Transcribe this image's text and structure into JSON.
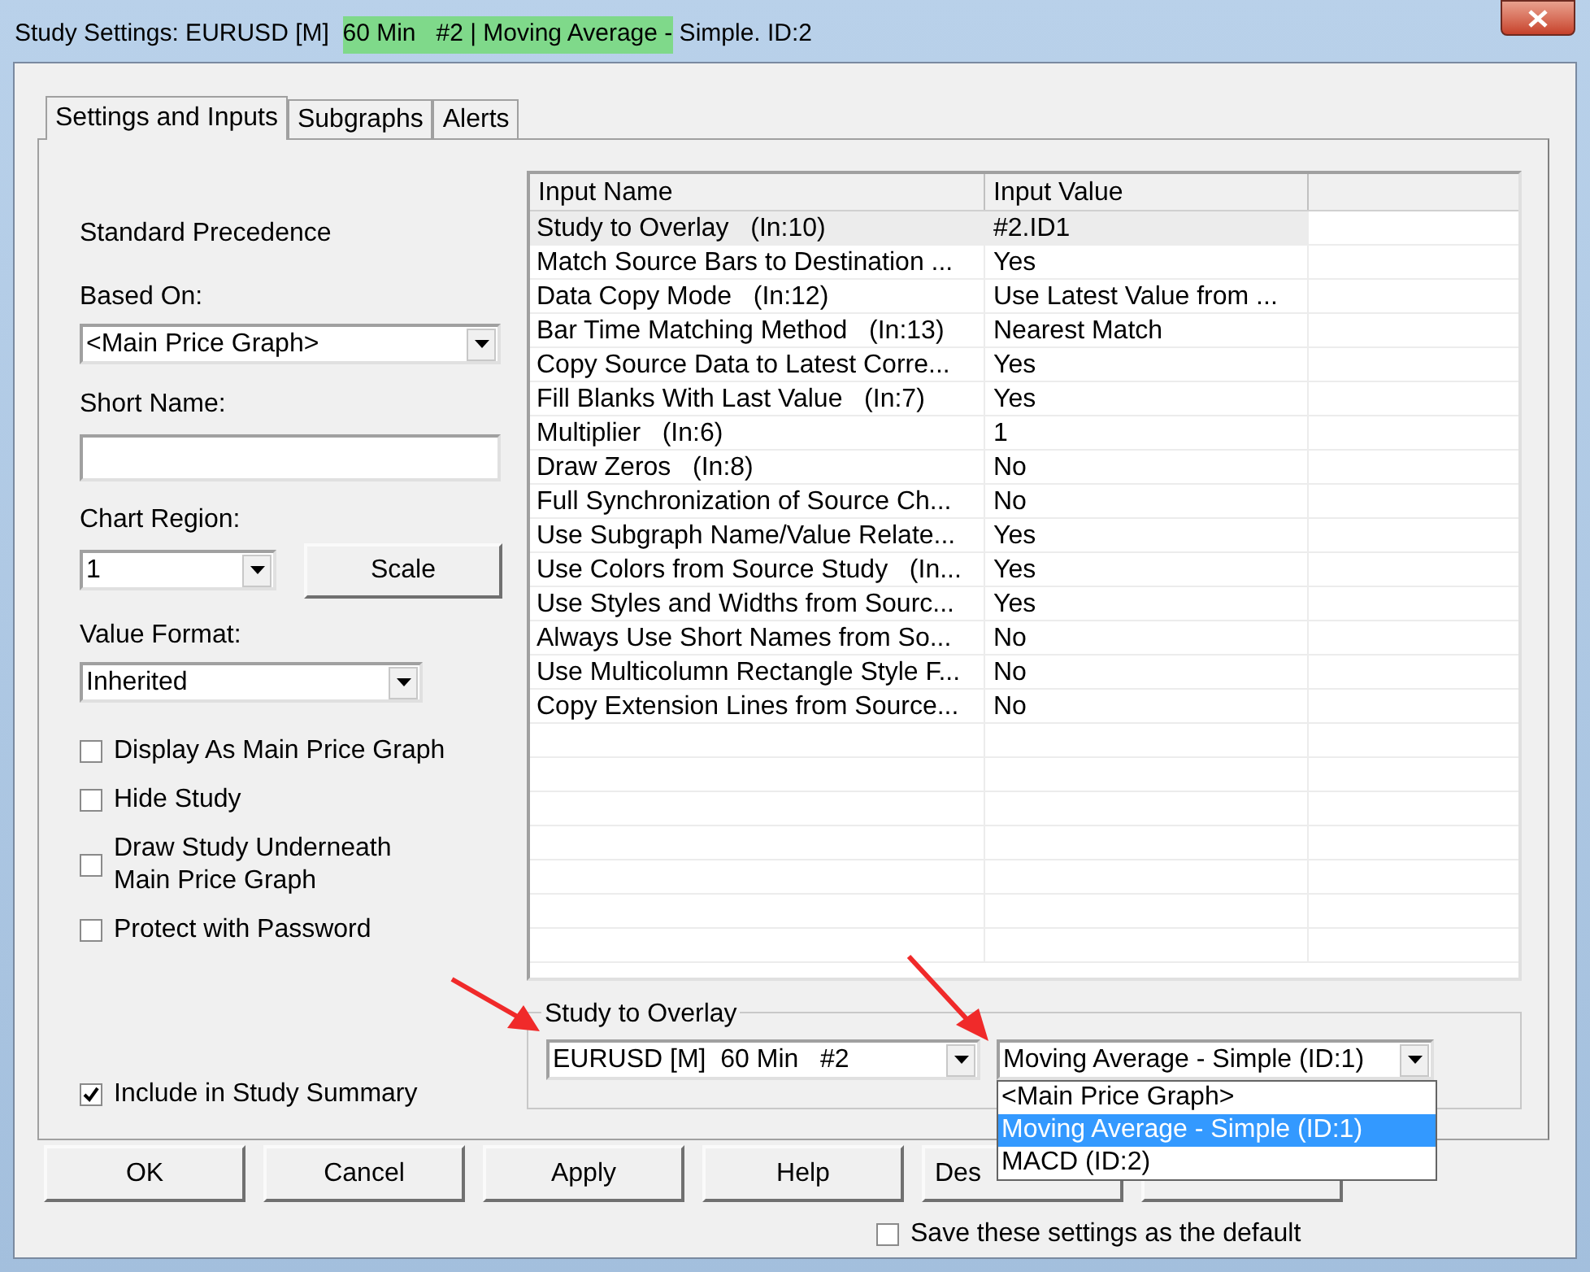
{
  "window": {
    "title": [
      {
        "text": "Study Settings: EURUSD [M]  ",
        "highlighted": false
      },
      {
        "text": "60 Min   #2 | Moving Average -",
        "highlighted": true
      },
      {
        "text": " Simple. ID:2",
        "highlighted": false
      }
    ]
  },
  "tabs": [
    {
      "label": "Settings and Inputs",
      "selected": true
    },
    {
      "label": "Subgraphs",
      "selected": false
    },
    {
      "label": "Alerts",
      "selected": false
    }
  ],
  "settings": {
    "precedence": "Standard Precedence",
    "based_on": {
      "label": "Based On:",
      "value": "<Main Price Graph>"
    },
    "short_name": {
      "label": "Short Name:"
    },
    "chart_region": {
      "label": "Chart Region:",
      "value": "1"
    },
    "scale_button": "Scale",
    "value_format": {
      "label": "Value Format:",
      "value": "Inherited"
    },
    "options": [
      {
        "label": "Display As Main Price Graph",
        "checked": false
      },
      {
        "label": "Hide Study",
        "checked": false
      },
      {
        "label": "Draw Study Underneath\nMain Price Graph",
        "checked": false
      },
      {
        "label": "Protect with Password",
        "checked": false
      }
    ],
    "include_summary": {
      "label": "Include in Study Summary",
      "checked": true
    }
  },
  "inputs": {
    "columns": [
      "Input Name",
      "Input Value"
    ],
    "rows": [
      {
        "name": "Study to Overlay   (In:10)",
        "value": "#2.ID1",
        "selected": true
      },
      {
        "name": "Match Source Bars to Destination ...",
        "value": "Yes",
        "selected": false
      },
      {
        "name": "Data Copy Mode   (In:12)",
        "value": "Use Latest Value from ...",
        "selected": false
      },
      {
        "name": "Bar Time Matching Method   (In:13)",
        "value": "Nearest Match",
        "selected": false
      },
      {
        "name": "Copy Source Data to Latest Corre...",
        "value": "Yes",
        "selected": false
      },
      {
        "name": "Fill Blanks With Last Value   (In:7)",
        "value": "Yes",
        "selected": false
      },
      {
        "name": "Multiplier   (In:6)",
        "value": "1",
        "selected": false
      },
      {
        "name": "Draw Zeros   (In:8)",
        "value": "No",
        "selected": false
      },
      {
        "name": "Full Synchronization of Source Ch...",
        "value": "No",
        "selected": false
      },
      {
        "name": "Use Subgraph Name/Value Relate...",
        "value": "Yes",
        "selected": false
      },
      {
        "name": "Use Colors from Source Study   (In...",
        "value": "Yes",
        "selected": false
      },
      {
        "name": "Use Styles and Widths from Sourc...",
        "value": "Yes",
        "selected": false
      },
      {
        "name": "Always Use Short Names from So...",
        "value": "No",
        "selected": false
      },
      {
        "name": "Use Multicolumn Rectangle Style F...",
        "value": "No",
        "selected": false
      },
      {
        "name": "Copy Extension Lines from Source...",
        "value": "No",
        "selected": false
      }
    ]
  },
  "study_to_overlay": {
    "legend": "Study to Overlay",
    "chart_value": "EURUSD [M]  60 Min   #2",
    "study_select": {
      "value": "Moving Average - Simple (ID:1)",
      "expanded": true,
      "options": [
        {
          "label": "<Main Price Graph>",
          "selected": false
        },
        {
          "label": "Moving Average - Simple (ID:1)",
          "selected": true
        },
        {
          "label": "MACD (ID:2)",
          "selected": false
        }
      ]
    }
  },
  "buttons": [
    {
      "kind": "full",
      "label": "OK"
    },
    {
      "kind": "full",
      "label": "Cancel"
    },
    {
      "kind": "full",
      "label": "Apply"
    },
    {
      "kind": "full",
      "label": "Help"
    },
    {
      "kind": "covered",
      "label": "Des"
    },
    {
      "kind": "hidden"
    }
  ],
  "save_default": {
    "label": "Save these settings as the default",
    "checked": false
  }
}
